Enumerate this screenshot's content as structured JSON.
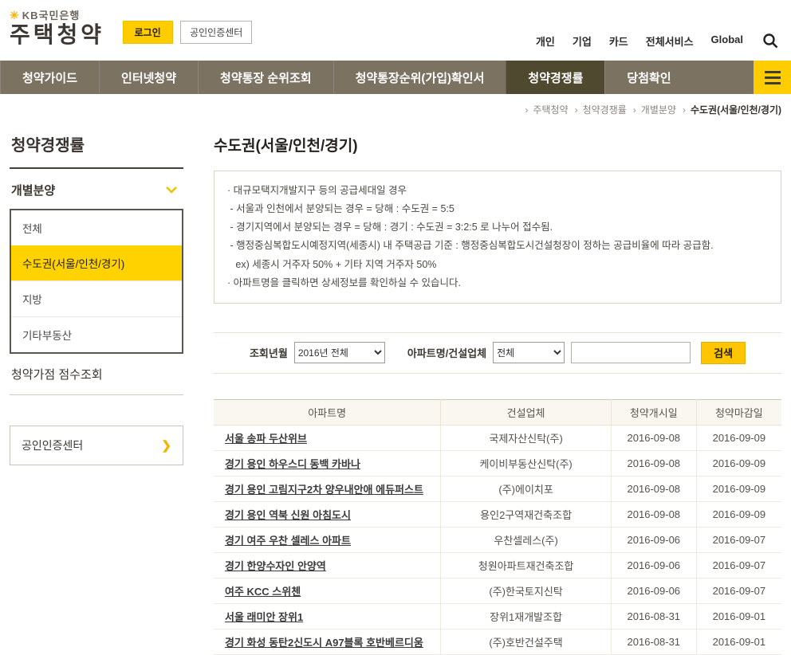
{
  "colors": {
    "kb_yellow": "#ffcc00",
    "nav_bg": "#7b7261",
    "nav_active_bg": "#4f4930",
    "selected_menu_bg": "#ffd200",
    "table_header_bg": "#f9f7f0"
  },
  "header": {
    "bank_name": "KB국민은행",
    "service_title": "주택청약",
    "login_label": "로그인",
    "cert_label": "공인인증센터",
    "utility_links": [
      "개인",
      "기업",
      "카드",
      "전체서비스",
      "Global"
    ]
  },
  "nav": {
    "items": [
      {
        "label": "청약가이드",
        "active": false
      },
      {
        "label": "인터넷청약",
        "active": false
      },
      {
        "label": "청약통장 순위조회",
        "active": false
      },
      {
        "label": "청약통장순위(가입)확인서",
        "active": false
      },
      {
        "label": "청약경쟁률",
        "active": true
      },
      {
        "label": "당첨확인",
        "active": false
      }
    ]
  },
  "breadcrumb": {
    "items": [
      "주택청약",
      "청약경쟁률",
      "개별분양",
      "수도권(서울/인천/경기)"
    ]
  },
  "sidebar": {
    "title": "청약경쟁률",
    "section_label": "개별분양",
    "menu_items": [
      {
        "label": "전체",
        "selected": false
      },
      {
        "label": "수도권(서울/인천/경기)",
        "selected": true
      },
      {
        "label": "지방",
        "selected": false
      },
      {
        "label": "기타부동산",
        "selected": false
      }
    ],
    "score_link_label": "청약가점 점수조회",
    "cert_link_label": "공인인증센터"
  },
  "main": {
    "title": "수도권(서울/인천/경기)",
    "notice_lines": [
      "· 대규모택지개발지구 등의 공급세대일 경우",
      " - 서울과 인천에서 분양되는 경우 = 당해 : 수도권 = 5:5",
      " - 경기지역에서 분양되는 경우 = 당해 : 경기 : 수도권 = 3:2:5 로 나누어 접수됨.",
      " - 행정중심복합도시예정지역(세종시) 내 주택공급 기준 : 행정중심복합도시건설청장이 정하는 공급비율에 따라 공급함.",
      "   ex) 세종시 거주자 50% + 기타 지역 거주자 50%",
      "· 아파트명을 클릭하면 상세정보를 확인하실 수 있습니다."
    ],
    "search": {
      "year_label": "조회년월",
      "year_value": "2016년 전체",
      "apt_label": "아파트명/건설업체",
      "apt_filter_value": "전체",
      "keyword_value": "",
      "search_button_label": "검색"
    },
    "table": {
      "headers": [
        "아파트명",
        "건설업체",
        "청약개시일",
        "청약마감일"
      ],
      "rows": [
        [
          "서울 송파 두산위브",
          "국제자산신탁(주)",
          "2016-09-08",
          "2016-09-09"
        ],
        [
          "경기 용인 하우스디 동백 카바나",
          "케이비부동산신탁(주)",
          "2016-09-08",
          "2016-09-09"
        ],
        [
          "경기 용인 고림지구2차 양우내안애 에듀퍼스트",
          "(주)에이치포",
          "2016-09-08",
          "2016-09-09"
        ],
        [
          "경기 용인 역북 신원 아침도시",
          "용인2구역재건축조합",
          "2016-09-08",
          "2016-09-09"
        ],
        [
          "경기 여주 우찬 셀레스 아파트",
          "우찬셀레스(주)",
          "2016-09-06",
          "2016-09-07"
        ],
        [
          "경기 한양수자인 안양역",
          "청원아파트재건축조합",
          "2016-09-06",
          "2016-09-07"
        ],
        [
          "여주 KCC 스위첸",
          "(주)한국토지신탁",
          "2016-09-06",
          "2016-09-07"
        ],
        [
          "서울 래미안 장위1",
          "장위1재개발조합",
          "2016-08-31",
          "2016-09-01"
        ],
        [
          "경기 화성 동탄2신도시 A97블록 호반베르디움",
          "(주)호반건설주택",
          "2016-08-31",
          "2016-09-01"
        ]
      ]
    }
  }
}
